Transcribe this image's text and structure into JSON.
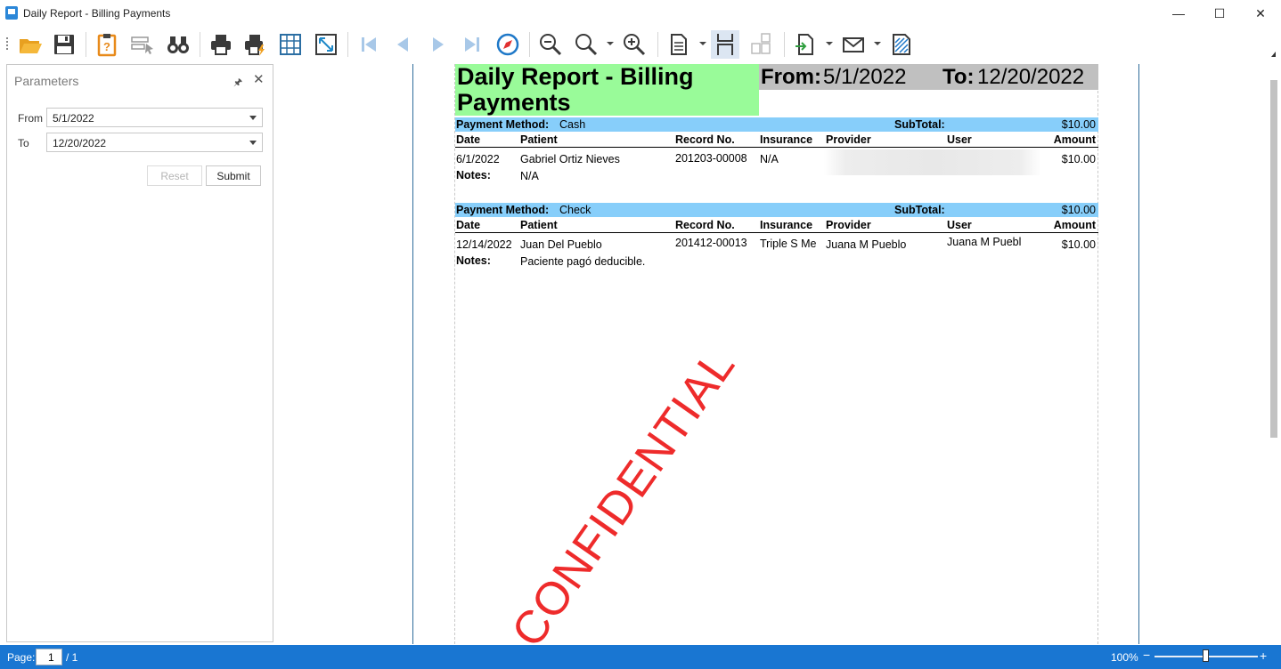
{
  "window": {
    "title": "Daily Report - Billing Payments",
    "controls": {
      "minimize": "—",
      "maximize": "☐",
      "close": "✕"
    }
  },
  "toolbar": {
    "buttons": [
      "open-folder-icon",
      "save-icon",
      "parameters-icon",
      "select-tool-icon",
      "find-icon",
      "print-icon",
      "quick-print-icon",
      "page-setup-icon",
      "scale-icon",
      "first-page-icon",
      "previous-page-icon",
      "next-page-icon",
      "last-page-icon",
      "navigate-icon",
      "zoom-out-icon",
      "zoom-icon",
      "zoom-in-icon",
      "single-page-icon",
      "continuous-page-icon",
      "multiple-pages-icon",
      "export-icon",
      "email-icon",
      "watermark-icon"
    ]
  },
  "parameters": {
    "title": "Parameters",
    "pin": "🖈",
    "close": "✕",
    "from_label": "From",
    "from_value": "5/1/2022",
    "to_label": "To",
    "to_value": "12/20/2022",
    "reset_label": "Reset",
    "submit_label": "Submit"
  },
  "report": {
    "title_line1": "Daily Report - Billing",
    "title_line2": "Payments",
    "from_label": "From:",
    "from_value": "5/1/2022",
    "to_label": "To:",
    "to_value": "12/20/2022",
    "columns": {
      "date": "Date",
      "patient": "Patient",
      "record": "Record No.",
      "insurance": "Insurance",
      "provider": "Provider",
      "user": "User",
      "amount": "Amount"
    },
    "groups": [
      {
        "method_label": "Payment Method:",
        "method_value": "Cash",
        "subtotal_label": "SubTotal:",
        "subtotal_value": "$10.00",
        "row": {
          "date": "6/1/2022",
          "patient": "Gabriel Ortiz Nieves",
          "record": "201203-00008",
          "insurance": "N/A",
          "provider": "",
          "user": "",
          "amount": "$10.00"
        },
        "notes_label": "Notes:",
        "notes_value": "N/A"
      },
      {
        "method_label": "Payment Method:",
        "method_value": "Check",
        "subtotal_label": "SubTotal:",
        "subtotal_value": "$10.00",
        "row": {
          "date": "12/14/2022",
          "patient": "Juan Del Pueblo",
          "record": "201412-00013",
          "insurance": "Triple S Me",
          "provider": "Juana M Pueblo",
          "user": "Juana M Puebl",
          "amount": "$10.00"
        },
        "notes_label": "Notes:",
        "notes_value": "Paciente pagó deducible."
      }
    ],
    "watermark": "CONFIDENTIAL"
  },
  "statusbar": {
    "page_label": "Page:",
    "page_value": "1",
    "page_total": "/ 1",
    "zoom": "100%",
    "zoom_minus": "−",
    "zoom_plus": "+"
  },
  "colors": {
    "title_bg": "#99fb99",
    "range_bg": "#c0c0c0",
    "band_bg": "#87cefa",
    "status_bg": "#1976d2",
    "watermark": "#ee2b2b"
  }
}
